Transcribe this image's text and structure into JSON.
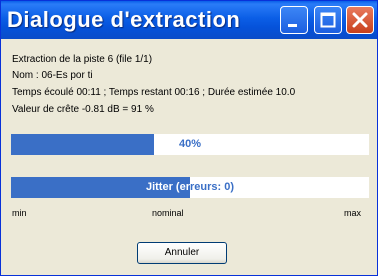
{
  "window": {
    "title": "Dialogue d'extraction"
  },
  "info": {
    "track_line": "Extraction de la piste 6 (file 1/1)",
    "name_line": "Nom : 06-Es por ti",
    "time_line": "Temps écoulé 00:11 ; Temps restant 00:16 ; Durée estimée 10.0",
    "peak_line": "Valeur de crête -0.81 dB =  91 %"
  },
  "progress": {
    "label": "40%",
    "fraction": 0.4
  },
  "jitter": {
    "label": "Jitter (erreurs: 0)",
    "fraction": 0.5,
    "scale_min": "min",
    "scale_mid": "nominal",
    "scale_max": "max"
  },
  "buttons": {
    "cancel": "Annuler"
  },
  "colors": {
    "bar_fill": "#3A6FC6",
    "title_bar": "#0B5EE6",
    "close": "#C8401C"
  },
  "icons": {
    "minimize": "minimize-icon",
    "maximize": "maximize-icon",
    "close": "close-icon"
  }
}
